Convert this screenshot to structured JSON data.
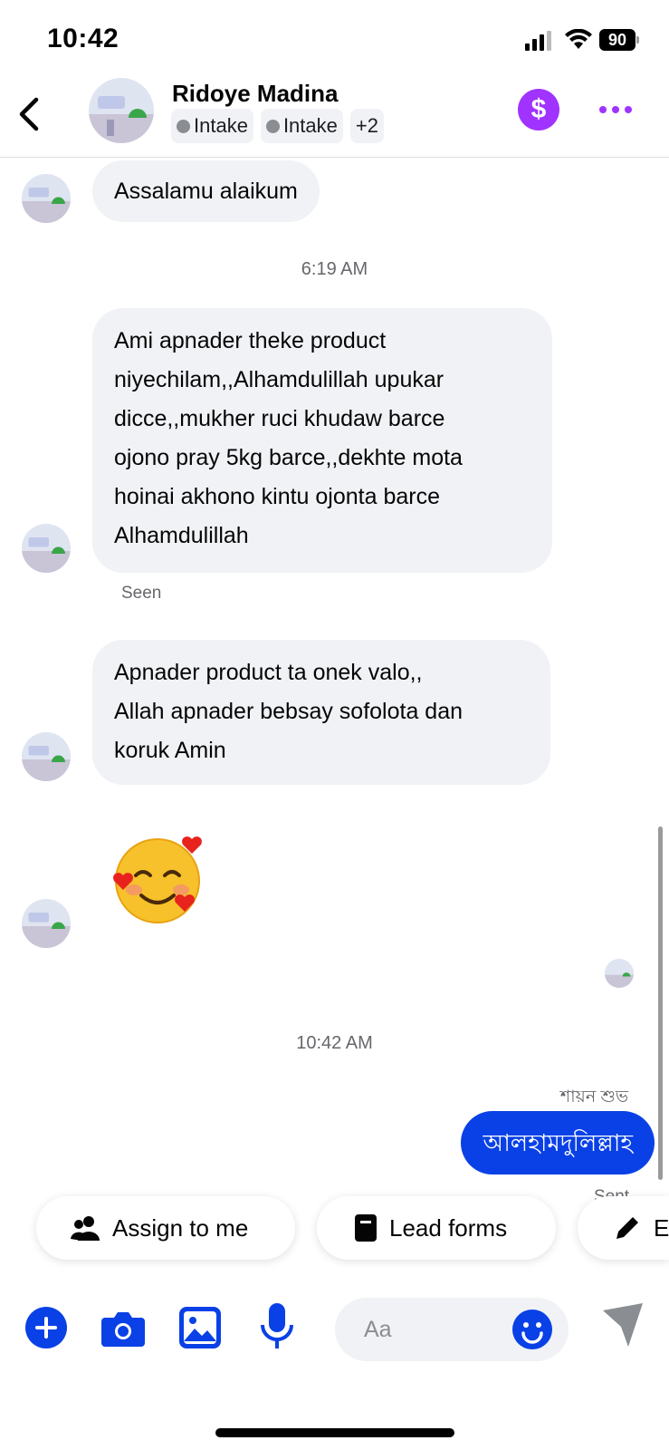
{
  "status_bar": {
    "time": "10:42",
    "battery": "90"
  },
  "header": {
    "name": "Ridoye Madina",
    "tags": [
      "Intake",
      "Intake"
    ],
    "more_tags": "+2",
    "dollar_symbol": "$"
  },
  "messages": {
    "m1": "Assalamu alaikum",
    "time1": "6:19 AM",
    "m2_lines": [
      "Ami apnader theke product",
      "niyechilam,,Alhamdulillah upukar",
      "dicce,,mukher ruci khudaw barce",
      "ojono pray 5kg barce,,dekhte mota",
      "hoinai akhono kintu ojonta barce",
      "Alhamdulillah"
    ],
    "seen": "Seen",
    "m3_lines": [
      "Apnader product ta onek valo,,",
      "Allah apnader bebsay sofolota dan",
      "koruk Amin"
    ],
    "m4_emoji": "smiling-face-with-hearts",
    "time2": "10:42 AM",
    "sender": "শায়ন শুভ",
    "m5": "আলহামদুলিল্লাহ",
    "sent": "Sent"
  },
  "quick_replies": {
    "assign": "Assign to me",
    "lead_forms": "Lead forms",
    "edit": "E"
  },
  "composer": {
    "placeholder": "Aa"
  },
  "colors": {
    "brand_blue": "#0a41e6",
    "purple": "#a033ff",
    "bubble_gray": "#f0f2f5"
  }
}
